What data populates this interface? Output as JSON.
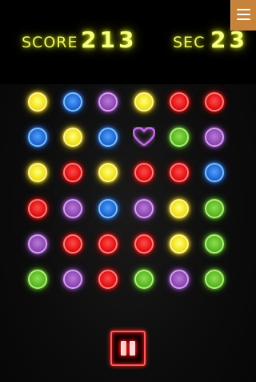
{
  "hud": {
    "score_label": "SCORE",
    "score_value": "213",
    "seconds_label": "SEC",
    "seconds_value": "23"
  },
  "menu": {
    "icon": "hamburger-menu-icon",
    "color": "#c7833a"
  },
  "pause": {
    "icon": "pause-icon",
    "color": "#ff5a5a"
  },
  "board": {
    "rows": [
      [
        "yellow",
        "blue",
        "purple",
        "yellow",
        "red",
        "red"
      ],
      [
        "blue",
        "yellow",
        "blue",
        "heart",
        "green",
        "purple"
      ],
      [
        "yellow",
        "red",
        "yellow",
        "red",
        "red",
        "blue"
      ],
      [
        "red",
        "purple",
        "blue",
        "purple",
        "yellow",
        "green"
      ],
      [
        "purple",
        "red",
        "red",
        "red",
        "yellow",
        "green"
      ],
      [
        "green",
        "purple",
        "red",
        "green",
        "purple",
        "green"
      ]
    ]
  },
  "colors": {
    "hud_text": "#ecf56a",
    "heart": "#c46be8"
  }
}
